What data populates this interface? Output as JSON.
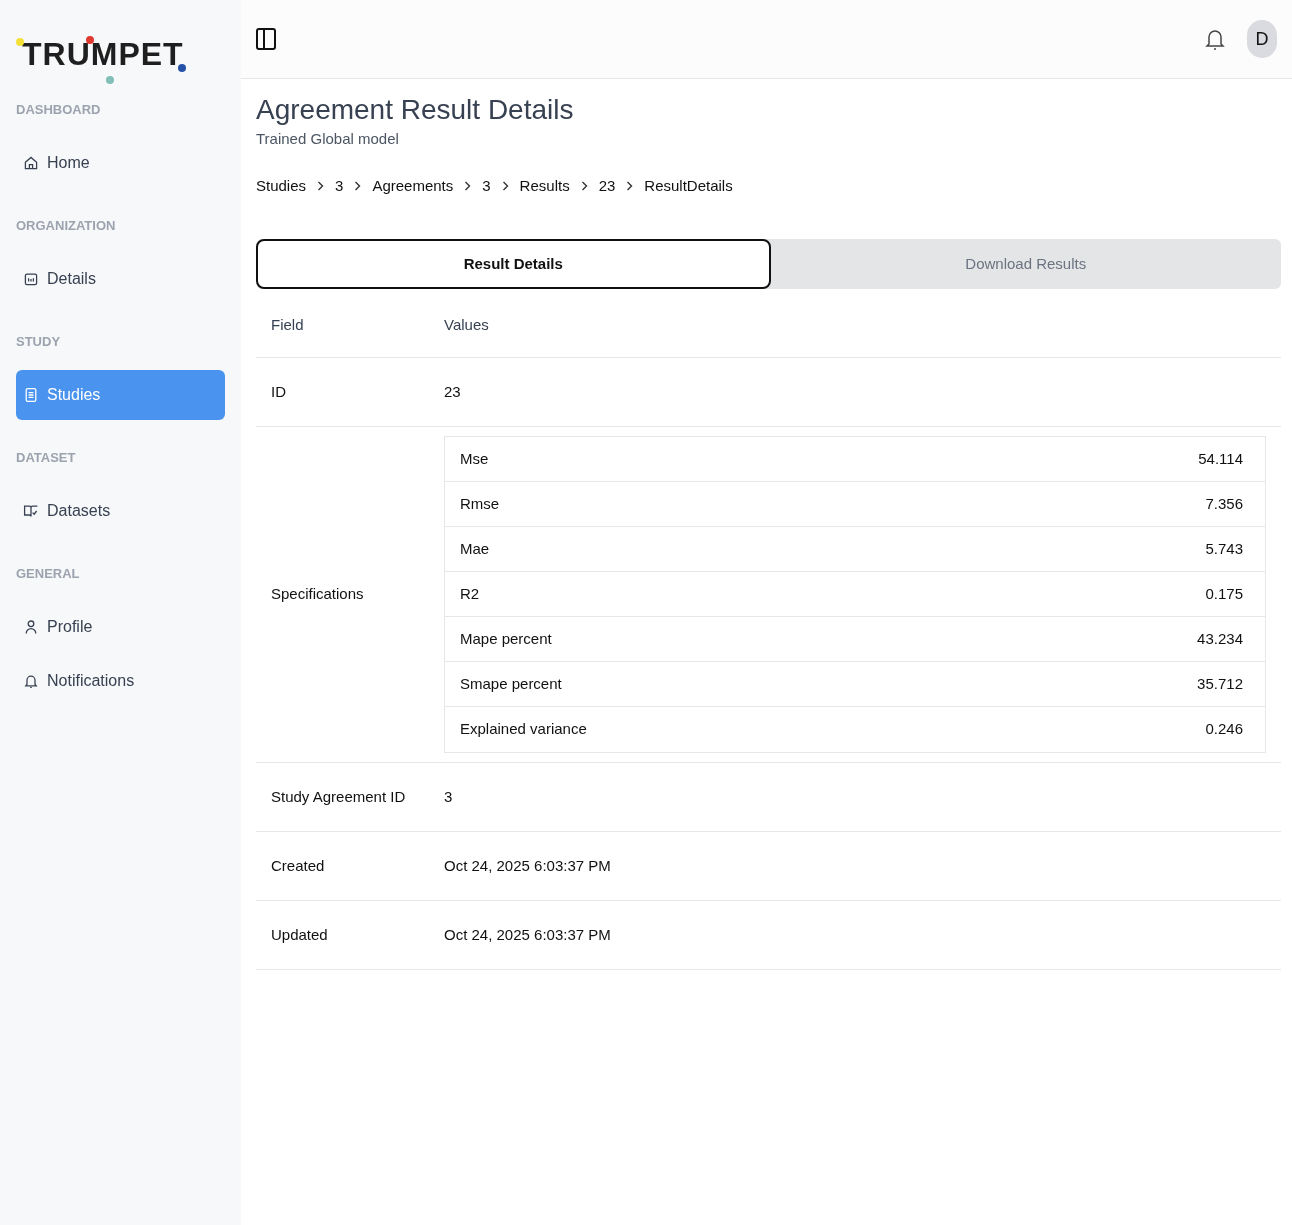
{
  "logo": {
    "text": "TRUMPET"
  },
  "sidebar": {
    "sections": [
      {
        "label": "DASHBOARD",
        "items": [
          {
            "label": "Home",
            "selected": false
          }
        ]
      },
      {
        "label": "ORGANIZATION",
        "items": [
          {
            "label": "Details",
            "selected": false
          }
        ]
      },
      {
        "label": "STUDY",
        "items": [
          {
            "label": "Studies",
            "selected": true
          }
        ]
      },
      {
        "label": "DATASET",
        "items": [
          {
            "label": "Datasets",
            "selected": false
          }
        ]
      },
      {
        "label": "GENERAL",
        "items": [
          {
            "label": "Profile",
            "selected": false
          },
          {
            "label": "Notifications",
            "selected": false
          }
        ]
      }
    ]
  },
  "header": {
    "avatar": "D"
  },
  "page": {
    "title": "Agreement Result Details",
    "subtitle": "Trained Global model"
  },
  "breadcrumbs": [
    "Studies",
    "3",
    "Agreements",
    "3",
    "Results",
    "23",
    "ResultDetails"
  ],
  "tabs": [
    {
      "label": "Result Details",
      "selected": true
    },
    {
      "label": "Download Results",
      "selected": false
    }
  ],
  "table": {
    "columns": [
      "Field",
      "Values"
    ],
    "rows": [
      {
        "field": "ID",
        "value": "23"
      },
      {
        "field": "Specifications",
        "specs": [
          {
            "name": "Mse",
            "value": "54.114"
          },
          {
            "name": "Rmse",
            "value": "7.356"
          },
          {
            "name": "Mae",
            "value": "5.743"
          },
          {
            "name": "R2",
            "value": "0.175"
          },
          {
            "name": "Mape percent",
            "value": "43.234"
          },
          {
            "name": "Smape percent",
            "value": "35.712"
          },
          {
            "name": "Explained variance",
            "value": "0.246"
          }
        ]
      },
      {
        "field": "Study Agreement ID",
        "value": "3"
      },
      {
        "field": "Created",
        "value": "Oct 24, 2025 6:03:37 PM"
      },
      {
        "field": "Updated",
        "value": "Oct 24, 2025 6:03:37 PM"
      }
    ]
  }
}
